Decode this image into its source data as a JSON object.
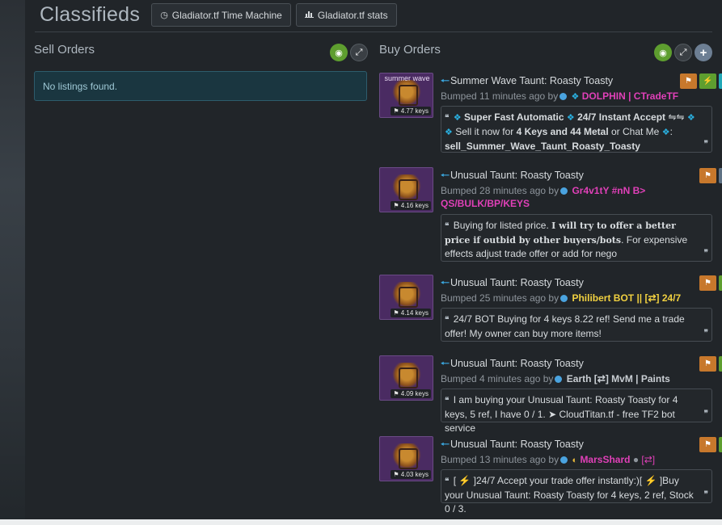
{
  "header": {
    "title": "Classifieds",
    "time_machine_label": "Gladiator.tf Time Machine",
    "stats_label": "Gladiator.tf stats"
  },
  "sell": {
    "title": "Sell Orders",
    "empty_text": "No listings found."
  },
  "buy": {
    "title": "Buy Orders",
    "listings": [
      {
        "effect": "summer wave",
        "price": "4.77 keys",
        "title": "Summer Wave Taunt: Roasty Toasty",
        "bumped": "Bumped 11 minutes ago by",
        "user": "DOLPHIN | CTradeTF",
        "desc_line1_bold": "Super Fast Automatic",
        "desc_line1_bold2": "24/7 Instant Accept",
        "desc_line1_sym": "⇋⇋",
        "desc_line2_a": "Sell it now for",
        "desc_line2_bold": "4 Keys and 44 Metal",
        "desc_line2_b": "or Chat Me",
        "desc_line2_c": ":",
        "desc_line3": "sell_Summer_Wave_Taunt_Roasty_Toasty"
      },
      {
        "price": "4.16 keys",
        "title": "Unusual Taunt: Roasty Toasty",
        "bumped": "Bumped 28 minutes ago by",
        "user": "Gr4v1tY #nN B> QS/BULK/BP/KEYS",
        "desc_a": "Buying for listed price.",
        "desc_bold": "I will try to offer a better price if outbid by other buyers/bots",
        "desc_b": ". For expensive effects adjust trade offer or add for nego"
      },
      {
        "price": "4.14 keys",
        "title": "Unusual Taunt: Roasty Toasty",
        "bumped": "Bumped 25 minutes ago by",
        "user": "Philibert BOT || [⇄] 24/7",
        "desc": "24/7 BOT Buying for 4 keys 8.22 ref! Send me a trade offer! My owner can buy more items!"
      },
      {
        "price": "4.09 keys",
        "title": "Unusual Taunt: Roasty Toasty",
        "bumped": "Bumped 4 minutes ago by",
        "user": "Earth [⇄] MvM | Paints",
        "desc": "I am buying your Unusual Taunt: Roasty Toasty for 4 keys, 5 ref, I have 0 / 1. ➤ CloudTitan.tf - free TF2 bot service"
      },
      {
        "price": "4.03 keys",
        "title": "Unusual Taunt: Roasty Toasty",
        "bumped": "Bumped 13 minutes ago by",
        "user": "MarsShard",
        "user_suffix": "[⇄]",
        "desc": "[ ⚡ ]24/7 Accept your trade offer instantly:)[ ⚡ ]Buy your Unusual Taunt: Roasty Toasty for 4 keys, 2 ref, Stock 0 / 3."
      }
    ]
  },
  "icons": {
    "eye": "eye-icon",
    "expand": "expand-icon",
    "plus": "plus-icon",
    "flag": "flag-icon",
    "lightning": "lightning-icon",
    "swap": "swap-icon",
    "clock": "clock-icon",
    "chart": "bar-chart-icon"
  },
  "colors": {
    "accent_green": "#5e9e2f",
    "flag_orange": "#c7782c",
    "instant_cyan": "#21a8b7",
    "user_pink": "#e040b8",
    "user_yellow": "#f0d040",
    "arrow_blue": "#3aa8e0"
  }
}
